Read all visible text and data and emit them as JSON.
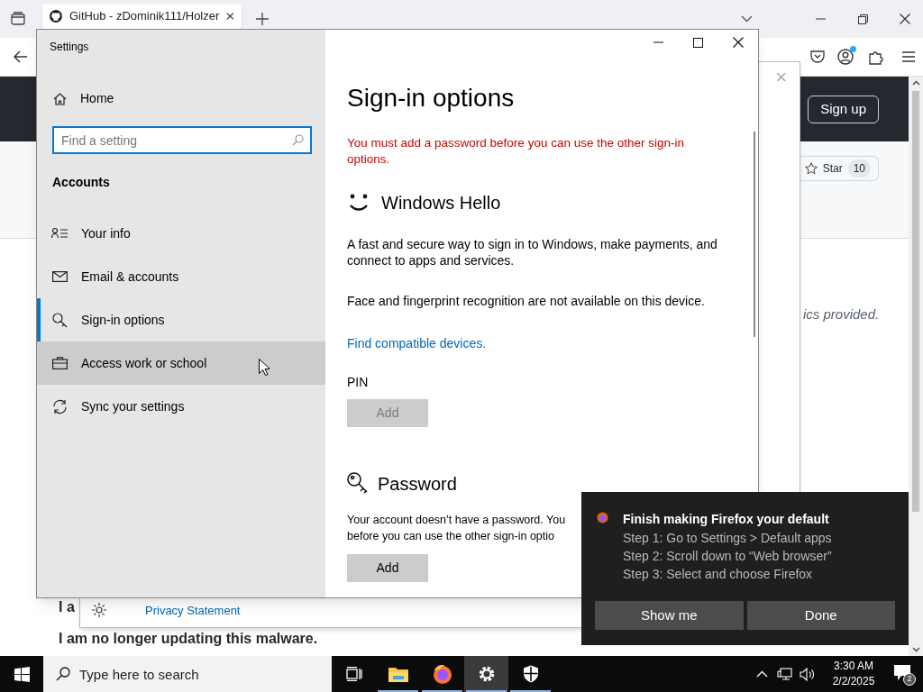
{
  "browser": {
    "tab_title": "GitHub - zDominik111/Holzer",
    "sign_up": "Sign up",
    "star_label": "Star",
    "star_count": "10",
    "about_fragment": "ics provided.",
    "readme_fragment": "I a",
    "readme_notice": "I am no longer updating this malware."
  },
  "dialog": {
    "close": "×",
    "link": "Privacy Statement"
  },
  "settings": {
    "title": "Settings",
    "home": "Home",
    "search_placeholder": "Find a setting",
    "section": "Accounts",
    "nav": [
      {
        "label": "Your info",
        "selected": false,
        "hovered": false
      },
      {
        "label": "Email & accounts",
        "selected": false,
        "hovered": false
      },
      {
        "label": "Sign-in options",
        "selected": true,
        "hovered": false
      },
      {
        "label": "Access work or school",
        "selected": false,
        "hovered": true
      },
      {
        "label": "Sync your settings",
        "selected": false,
        "hovered": false
      }
    ],
    "heading": "Sign-in options",
    "warning": "You must add a password before you can use the other sign-in options.",
    "hello_title": "Windows Hello",
    "hello_text": "A fast and secure way to sign in to Windows, make payments, and connect to apps and services.",
    "hello_note": "Face and fingerprint recognition are not available on this device.",
    "hello_link": "Find compatible devices.",
    "pin_label": "PIN",
    "pin_button": {
      "label": "Add",
      "disabled": true
    },
    "password_title": "Password",
    "password_lines": [
      "Your account doesn’t have a password. You",
      "before you can use the other sign-in optio"
    ],
    "password_button": {
      "label": "Add",
      "disabled": false
    }
  },
  "notification": {
    "title": "Finish making Firefox your default",
    "lines": [
      "Step 1: Go to Settings > Default apps",
      "Step 2: Scroll down to “Web browser”",
      "Step 3: Select and choose Firefox"
    ],
    "buttons": [
      "Show me",
      "Done"
    ]
  },
  "taskbar": {
    "search_placeholder": "Type here to search",
    "apps": [
      {
        "running": false,
        "selected": false
      },
      {
        "running": true,
        "selected": false
      },
      {
        "running": true,
        "selected": false
      },
      {
        "running": true,
        "selected": true
      },
      {
        "running": true,
        "selected": false
      }
    ],
    "time": "3:30 AM",
    "date": "2/2/2025",
    "notification_count": "2"
  }
}
